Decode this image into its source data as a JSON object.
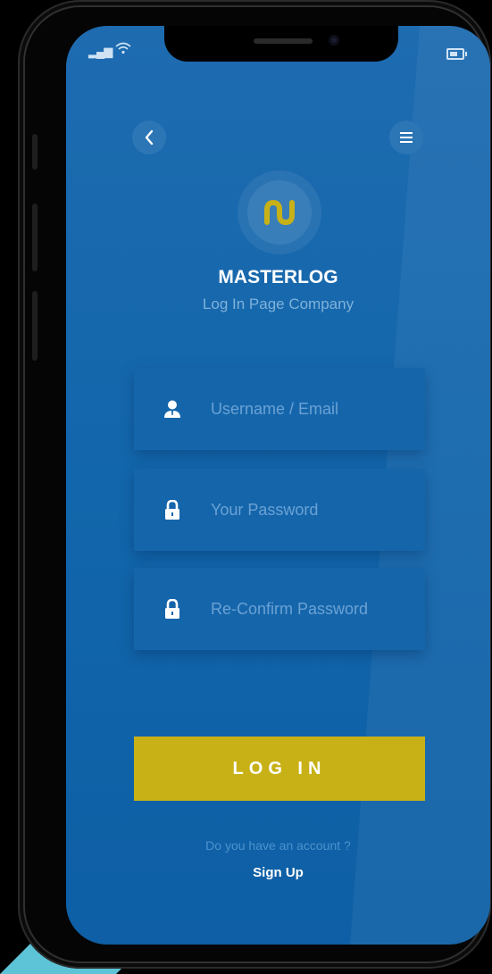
{
  "brand": {
    "name": "MASTERLOG",
    "subtitle": "Log In Page Company",
    "accent_color": "#C8B116",
    "background_color": "#1266AB"
  },
  "header": {
    "back_icon": "chevron-left-icon",
    "menu_icon": "hamburger-menu-icon"
  },
  "status_bar": {
    "signal_icon": "signal-icon",
    "wifi_icon": "wifi-icon",
    "battery_icon": "battery-icon"
  },
  "form": {
    "username_placeholder": "Username / Email",
    "password_placeholder": "Your Password",
    "confirm_placeholder": "Re-Confirm Password",
    "login_label": "LOG IN"
  },
  "footer": {
    "question": "Do you have an account ?",
    "signup_label": "Sign Up"
  }
}
